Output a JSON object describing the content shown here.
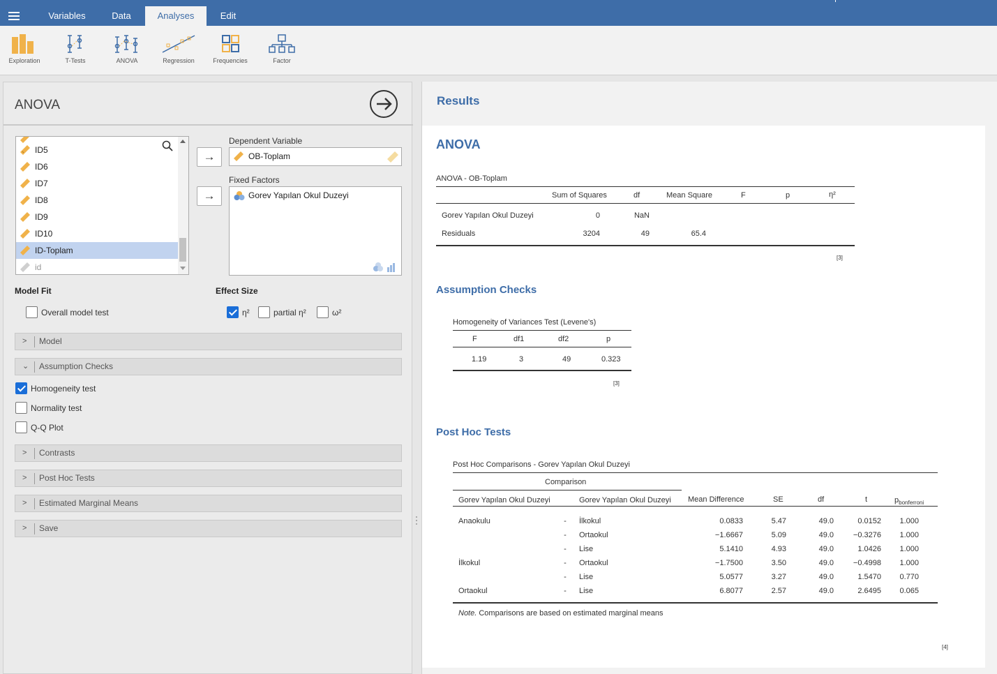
{
  "nav": {
    "tabs": [
      {
        "label": "Variables"
      },
      {
        "label": "Data"
      },
      {
        "label": "Analyses",
        "active": true
      },
      {
        "label": "Edit"
      }
    ]
  },
  "ribbon": {
    "buttons": [
      {
        "label": "Exploration",
        "icon": "exploration-icon"
      },
      {
        "label": "T-Tests",
        "icon": "ttests-icon"
      },
      {
        "label": "ANOVA",
        "icon": "anova-icon"
      },
      {
        "label": "Regression",
        "icon": "regression-icon"
      },
      {
        "label": "Frequencies",
        "icon": "frequencies-icon"
      },
      {
        "label": "Factor",
        "icon": "factor-icon"
      }
    ]
  },
  "left": {
    "title": "ANOVA",
    "variables": [
      {
        "name": "ID5"
      },
      {
        "name": "ID6"
      },
      {
        "name": "ID7"
      },
      {
        "name": "ID8"
      },
      {
        "name": "ID9"
      },
      {
        "name": "ID10"
      },
      {
        "name": "ID-Toplam",
        "selected": true
      },
      {
        "name": "id",
        "type": "id"
      }
    ],
    "dependent": {
      "label": "Dependent Variable",
      "value": "OB-Toplam"
    },
    "factors": {
      "label": "Fixed Factors",
      "items": [
        "Gorev Yapılan Okul Duzeyi"
      ]
    },
    "model_fit": {
      "label": "Model Fit",
      "overall": {
        "label": "Overall model test",
        "checked": false
      }
    },
    "effect_size": {
      "label": "Effect Size",
      "eta": {
        "label": "η²",
        "checked": true
      },
      "partial": {
        "label": "partial η²",
        "checked": false
      },
      "omega": {
        "label": "ω²",
        "checked": false
      }
    },
    "sections": {
      "model": "Model",
      "assumption": "Assumption Checks",
      "contrasts": "Contrasts",
      "posthoc": "Post Hoc Tests",
      "emm": "Estimated Marginal Means",
      "save": "Save"
    },
    "assumption_options": [
      {
        "label": "Homogeneity test",
        "checked": true
      },
      {
        "label": "Normality test",
        "checked": false
      },
      {
        "label": "Q-Q Plot",
        "checked": false
      }
    ]
  },
  "results": {
    "header": "Results",
    "anova_title": "ANOVA",
    "anova_table": {
      "caption": "ANOVA - OB-Toplam",
      "headers": [
        "Sum of Squares",
        "df",
        "Mean Square",
        "F",
        "p",
        "η²"
      ],
      "rows": [
        {
          "name": "Gorev Yapılan Okul Duzeyi",
          "ss": "0",
          "df": "NaN",
          "ms": "",
          "f": "",
          "p": "",
          "eta": ""
        },
        {
          "name": "Residuals",
          "ss": "3204",
          "df": "49",
          "ms": "65.4",
          "f": "",
          "p": "",
          "eta": ""
        }
      ],
      "footnote": "[3]"
    },
    "assumption_title": "Assumption Checks",
    "levene": {
      "caption": "Homogeneity of Variances Test (Levene's)",
      "headers": [
        "F",
        "df1",
        "df2",
        "p"
      ],
      "values": [
        "1.19",
        "3",
        "49",
        "0.323"
      ],
      "footnote": "[3]"
    },
    "posthoc_title": "Post Hoc Tests",
    "posthoc": {
      "caption": "Post Hoc Comparisons - Gorev Yapılan Okul Duzeyi",
      "comparison_header": "Comparison",
      "headers": [
        "Gorev Yapılan Okul Duzeyi",
        "Gorev Yapılan Okul Duzeyi",
        "Mean Difference",
        "SE",
        "df",
        "t"
      ],
      "pbonf_main": "p",
      "pbonf_sub": "bonferroni",
      "rows": [
        {
          "g1": "Anaokulu",
          "dash": "-",
          "g2": "İlkokul",
          "md": "0.0833",
          "se": "5.47",
          "df": "49.0",
          "t": "0.0152",
          "p": "1.000"
        },
        {
          "g1": "",
          "dash": "-",
          "g2": "Ortaokul",
          "md": "−1.6667",
          "se": "5.09",
          "df": "49.0",
          "t": "−0.3276",
          "p": "1.000"
        },
        {
          "g1": "",
          "dash": "-",
          "g2": "Lise",
          "md": "5.1410",
          "se": "4.93",
          "df": "49.0",
          "t": "1.0426",
          "p": "1.000"
        },
        {
          "g1": "İlkokul",
          "dash": "-",
          "g2": "Ortaokul",
          "md": "−1.7500",
          "se": "3.50",
          "df": "49.0",
          "t": "−0.4998",
          "p": "1.000"
        },
        {
          "g1": "",
          "dash": "-",
          "g2": "Lise",
          "md": "5.0577",
          "se": "3.27",
          "df": "49.0",
          "t": "1.5470",
          "p": "0.770"
        },
        {
          "g1": "Ortaokul",
          "dash": "-",
          "g2": "Lise",
          "md": "6.8077",
          "se": "2.57",
          "df": "49.0",
          "t": "2.6495",
          "p": "0.065"
        }
      ],
      "note_label": "Note.",
      "note_text": "Comparisons are based on estimated marginal means",
      "footnote": "[4]"
    }
  },
  "colors": {
    "accent": "#3e6da8",
    "ribbon": "#f2f2f2",
    "checkbox": "#1a6ed8",
    "selection": "#c1d3ef"
  }
}
